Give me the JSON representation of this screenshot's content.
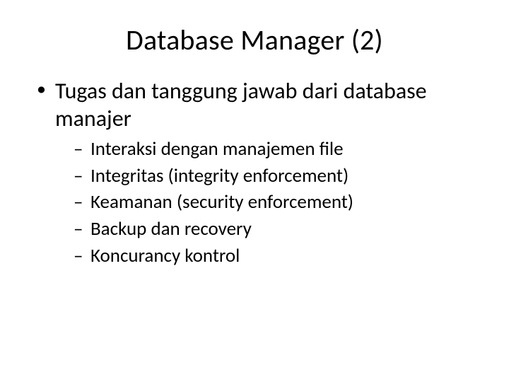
{
  "title": "Database Manager (2)",
  "bullets": [
    {
      "text": "Tugas dan tanggung jawab dari database manajer",
      "sub": [
        "Interaksi dengan manajemen file",
        "Integritas (integrity enforcement)",
        "Keamanan (security enforcement)",
        "Backup dan recovery",
        "Koncurancy kontrol"
      ]
    }
  ]
}
